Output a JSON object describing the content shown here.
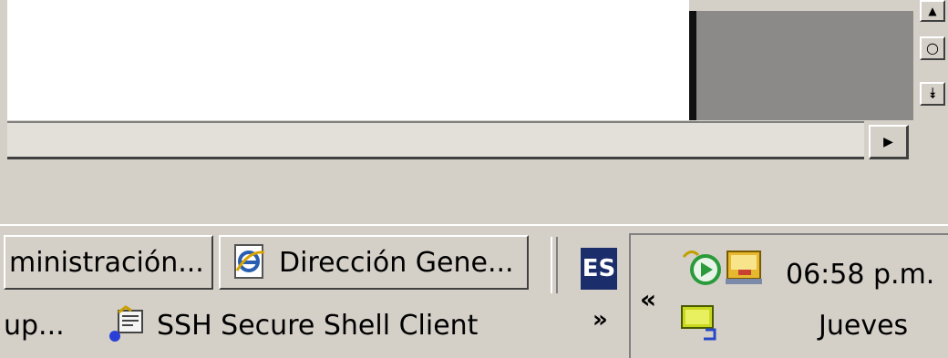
{
  "document": {
    "vscroll": {
      "up_glyph": "▲",
      "mid_glyph": "○",
      "down_glyph": "⯯"
    },
    "hscroll": {
      "right_glyph": "▶"
    }
  },
  "taskbar": {
    "buttons_row1": [
      {
        "label": "ministración...",
        "icon": "window-icon"
      },
      {
        "label": "Dirección Gene...",
        "icon": "internet-explorer-icon"
      }
    ],
    "buttons_row2": [
      {
        "label": "up...",
        "icon": ""
      },
      {
        "label": "SSH Secure Shell Client",
        "icon": "ssh-client-icon"
      }
    ],
    "more_glyph": "»",
    "language_indicator": "ES"
  },
  "tray": {
    "show_hidden_glyph": "«",
    "icons": [
      "media-player-icon",
      "network-icon",
      "monitor-icon"
    ],
    "time": "06:58 p.m.",
    "day": "Jueves"
  },
  "colors": {
    "face": "#d4d0c8",
    "highlight": "#ffffff",
    "shadow": "#404040",
    "lang_bg": "#1c2d6b"
  }
}
